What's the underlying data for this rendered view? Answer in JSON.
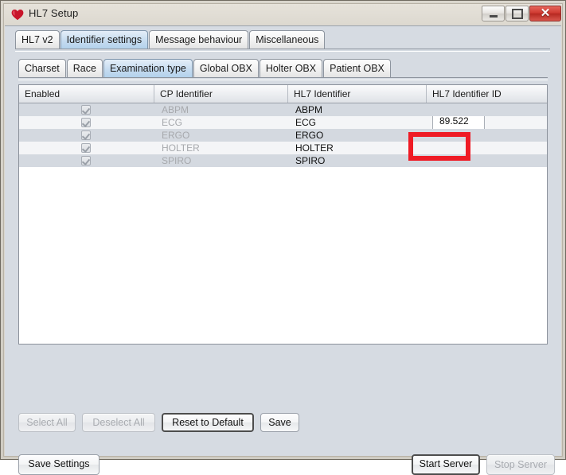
{
  "window": {
    "title": "HL7 Setup",
    "icon": "heart-icon",
    "controls": {
      "minimize": "minimize-icon",
      "maximize": "maximize-icon",
      "close": "✕"
    }
  },
  "tabs_outer": {
    "selected": "Identifier settings",
    "items": [
      {
        "label": "HL7 v2"
      },
      {
        "label": "Identifier settings"
      },
      {
        "label": "Message behaviour"
      },
      {
        "label": "Miscellaneous"
      }
    ]
  },
  "tabs_inner": {
    "selected": "Examination type",
    "items": [
      {
        "label": "Charset"
      },
      {
        "label": "Race"
      },
      {
        "label": "Examination type"
      },
      {
        "label": "Global OBX"
      },
      {
        "label": "Holter OBX"
      },
      {
        "label": "Patient OBX"
      }
    ]
  },
  "table": {
    "columns": [
      "Enabled",
      "CP Identifier",
      "HL7 Identifier",
      "HL7 Identifier ID"
    ],
    "rows": [
      {
        "enabled": true,
        "cp": "ABPM",
        "hl7": "ABPM",
        "id": ""
      },
      {
        "enabled": true,
        "cp": "ECG",
        "hl7": "ECG",
        "id": "89.522"
      },
      {
        "enabled": true,
        "cp": "ERGO",
        "hl7": "ERGO",
        "id": ""
      },
      {
        "enabled": true,
        "cp": "HOLTER",
        "hl7": "HOLTER",
        "id": ""
      },
      {
        "enabled": true,
        "cp": "SPIRO",
        "hl7": "SPIRO",
        "id": ""
      }
    ],
    "editing_value": "89.522"
  },
  "annotation": {
    "color": "#ef1b25",
    "target": "hl7-identifier-id-field-ecg"
  },
  "buttons": {
    "select_all": "Select All",
    "deselect_all": "Deselect All",
    "reset_to_default": "Reset to Default",
    "save": "Save",
    "save_settings": "Save Settings",
    "start_server": "Start Server",
    "stop_server": "Stop Server"
  }
}
